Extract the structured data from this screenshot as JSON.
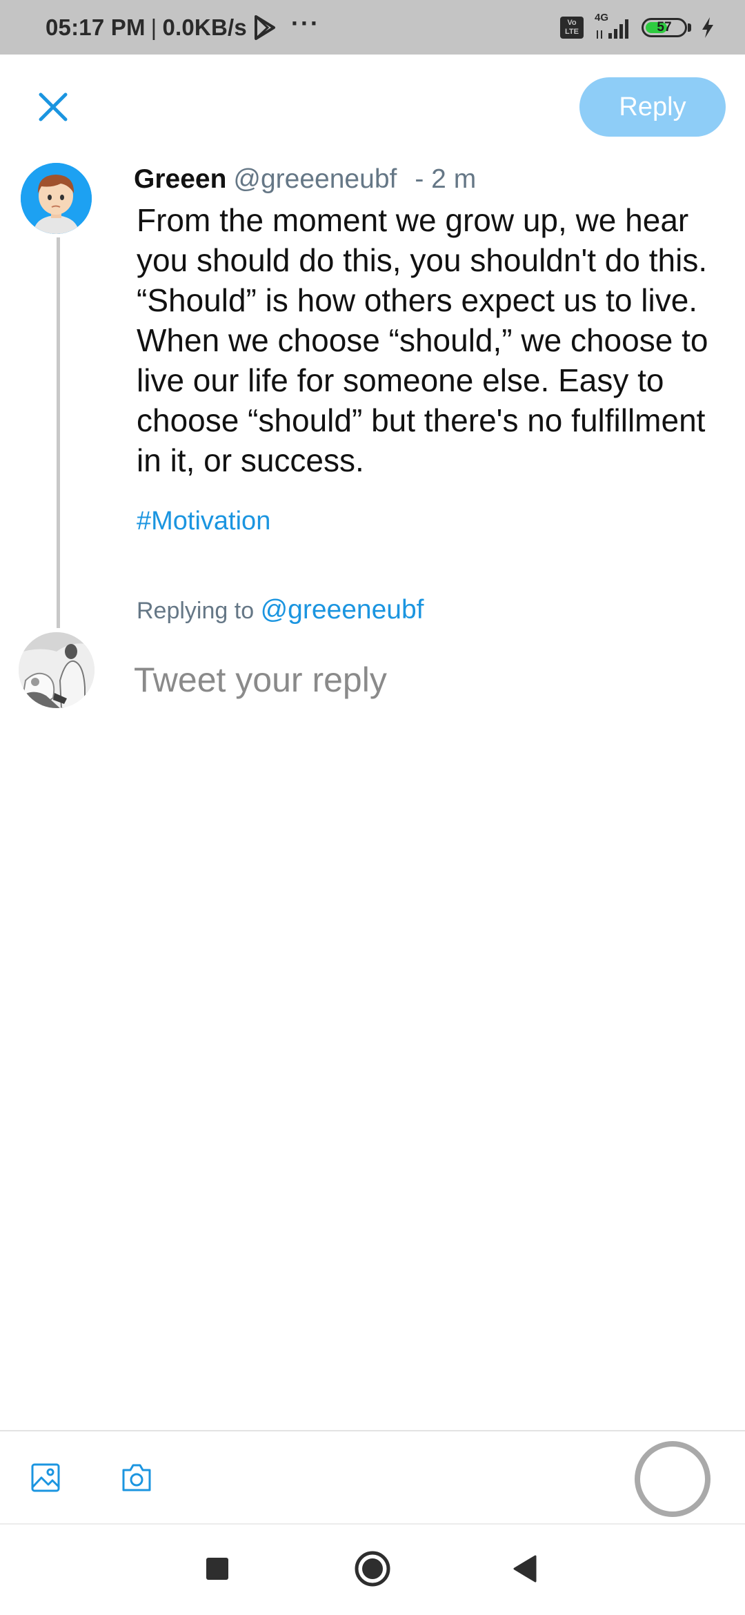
{
  "status_bar": {
    "time": "05:17 PM",
    "separator": "|",
    "net_speed": "0.0KB/s",
    "more": "···",
    "volte": "Vo LTE",
    "network": "4G",
    "battery_level": 57,
    "battery_label": "57",
    "colors": {
      "background": "#c4c4c4",
      "battery_fill": "#2ecc40"
    }
  },
  "header": {
    "close_icon": "close-icon",
    "reply_label": "Reply",
    "colors": {
      "accent": "#1b95e0",
      "reply_disabled": "#8ecdf7"
    }
  },
  "tweet": {
    "author_name": "Greeen",
    "author_handle": "@greeeneubf",
    "time": "- 2 m",
    "text": "From the moment we grow up, we hear you should do this, you shouldn't do this. “Should” is how others expect us to live. When we choose “should,” we choose to live our life for someone else. Easy to choose “should” but there's no fulfillment in it, or success.",
    "hashtag": "#Motivation"
  },
  "reply": {
    "replying_to_label": "Replying to",
    "replying_to_handle": "@greeeneubf",
    "placeholder": "Tweet your reply",
    "value": ""
  },
  "toolbar": {
    "items": [
      "image-icon",
      "camera-icon"
    ],
    "char_counter": "character-count-ring"
  },
  "nav": {
    "items": [
      "recents-square-icon",
      "home-circle-icon",
      "back-triangle-icon"
    ]
  }
}
